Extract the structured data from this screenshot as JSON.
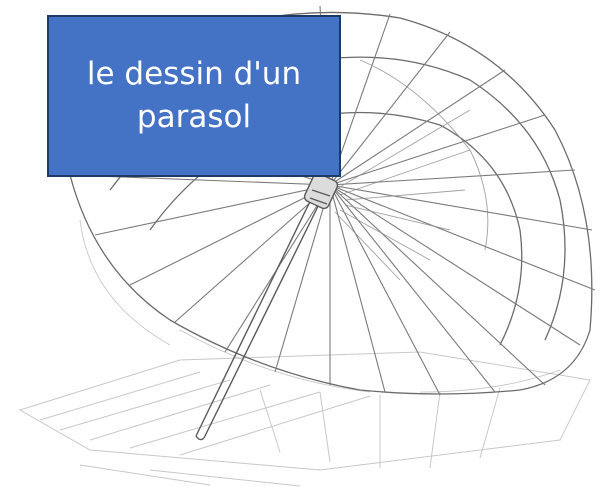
{
  "caption": {
    "text": "le dessin d'un parasol"
  },
  "colors": {
    "caption_fill": "#4472c4",
    "caption_border": "#1f3864",
    "caption_text": "#ffffff",
    "pencil": "#6b6b6b"
  },
  "illustration": {
    "subject": "parasol-sketch",
    "style": "pencil-drawing"
  }
}
